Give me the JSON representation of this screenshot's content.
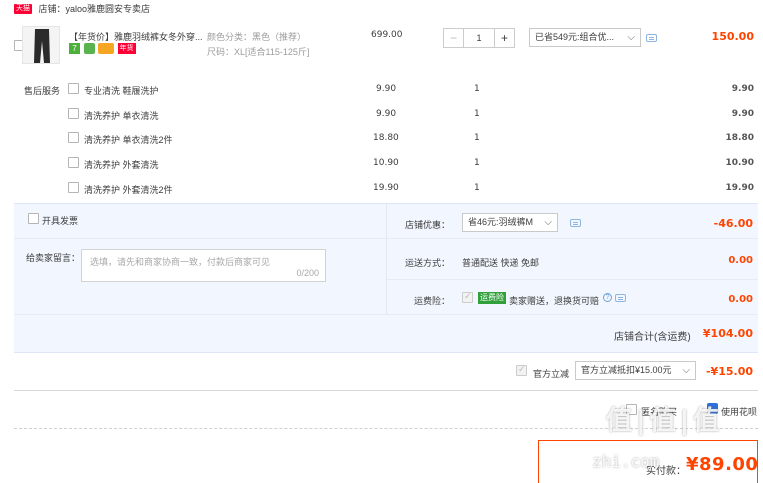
{
  "shop": {
    "badge": "天猫",
    "label": "店铺：yaloo雅鹿圆安专卖店"
  },
  "item": {
    "title": "【年货价】雅鹿羽绒裤女冬外穿...",
    "tag": "年货",
    "attr_color": "颜色分类：黑色（推荐）",
    "attr_size": "尺码：XL[适合115-125斤]",
    "price": "699.00",
    "quantity": "1",
    "promo_select": "已省549元:组合优...",
    "subtotal": "150.00"
  },
  "service": {
    "heading": "售后服务",
    "options": [
      {
        "label": "专业清洗 鞋履洗护",
        "price": "9.90",
        "qty": "1",
        "total": "9.90"
      },
      {
        "label": "清洗养护 单衣清洗",
        "price": "9.90",
        "qty": "1",
        "total": "9.90"
      },
      {
        "label": "清洗养护 单衣清洗2件",
        "price": "18.80",
        "qty": "1",
        "total": "18.80"
      },
      {
        "label": "清洗养护 外套清洗",
        "price": "10.90",
        "qty": "1",
        "total": "10.90"
      },
      {
        "label": "清洗养护 外套清洗2件",
        "price": "19.90",
        "qty": "1",
        "total": "19.90"
      }
    ]
  },
  "invoice": {
    "label": "开具发票"
  },
  "message": {
    "label": "给卖家留言：",
    "placeholder": "选填，请先和商家协商一致，付款后商家可见",
    "counter": "0/200"
  },
  "summary": {
    "discount_label": "店铺优惠：",
    "discount_select": "省46元:羽绒裤M",
    "discount_amount": "-46.00",
    "shipping_label": "运送方式：",
    "shipping_value": "普通配送 快递 免邮",
    "shipping_amount": "0.00",
    "insurance_label": "运费险：",
    "insurance_badge": "运费险",
    "insurance_text": "卖家赠送，退换货可赔",
    "insurance_amount": "0.00",
    "total_label": "店铺合计(含运费)",
    "total_value": "¥104.00"
  },
  "official": {
    "label": "官方立减",
    "select": "官方立减抵扣¥15.00元",
    "amount": "-¥15.00"
  },
  "footer": {
    "option1": "匿名购买",
    "option2": "使用花呗",
    "pay_label": "实付款：",
    "pay_amount": "¥89.00"
  },
  "watermark": {
    "logo": "值|值|值",
    "text": "zhi.com"
  },
  "colors": {
    "accent": "#ff4400",
    "panel": "#f2f7ff",
    "select_border": "#c9c9c9"
  }
}
